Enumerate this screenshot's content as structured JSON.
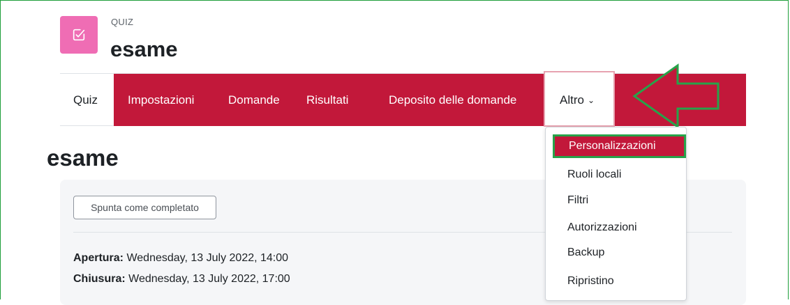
{
  "header": {
    "kicker": "QUIZ",
    "title": "esame",
    "icon": "checkbox-edit-icon",
    "icon_color": "#ef6db4"
  },
  "nav": {
    "accent_color": "#c2183a",
    "items": [
      {
        "label": "Quiz"
      },
      {
        "label": "Impostazioni"
      },
      {
        "label": "Domande"
      },
      {
        "label": "Risultati"
      },
      {
        "label": "Deposito delle domande"
      }
    ],
    "more_label": "Altro",
    "more_icon": "chevron-down-icon"
  },
  "page_heading": "esame",
  "card": {
    "complete_button": "Spunta come completato",
    "opening_label": "Apertura:",
    "opening_value": "Wednesday, 13 July 2022, 14:00",
    "closing_label": "Chiusura:",
    "closing_value": "Wednesday, 13 July 2022, 17:00"
  },
  "dropdown": {
    "items": [
      {
        "label": "Personalizzazioni",
        "highlighted": true
      },
      {
        "label": "Ruoli locali"
      },
      {
        "label": "Filtri"
      },
      {
        "label": "Autorizzazioni"
      },
      {
        "label": "Backup"
      },
      {
        "label": "Ripristino"
      }
    ]
  },
  "annotation": {
    "type": "arrow-left",
    "color": "#27a34a"
  }
}
